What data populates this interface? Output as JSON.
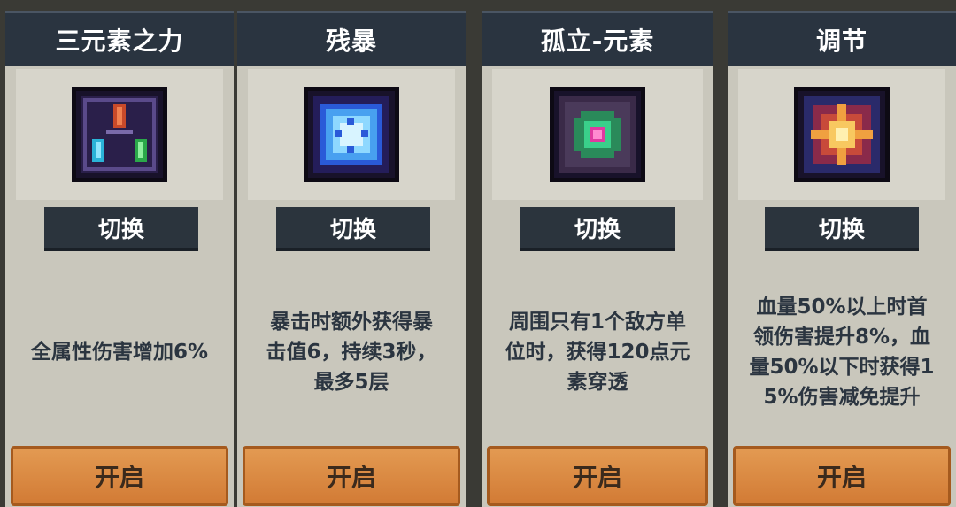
{
  "cards": [
    {
      "title": "三元素之力",
      "icon": "tri-element-crystals-icon",
      "switch_label": "切换",
      "description": "全属性伤害增加6%",
      "open_label": "开启"
    },
    {
      "title": "残暴",
      "icon": "brutal-blue-crystal-icon",
      "switch_label": "切换",
      "description": "暴击时额外获得暴\n击值6，持续3秒，\n最多5层",
      "open_label": "开启"
    },
    {
      "title": "孤立-元素",
      "icon": "isolated-element-orb-icon",
      "switch_label": "切换",
      "description": "周围只有1个敌方单\n位时，获得120点元\n素穿透",
      "open_label": "开启"
    },
    {
      "title": "调节",
      "icon": "adjust-burst-icon",
      "switch_label": "切换",
      "description": "血量50%以上时首\n领伤害提升8%，血\n量50%以下时获得1\n5%伤害减免提升",
      "open_label": "开启"
    }
  ],
  "colors": {
    "card_bg": "#c9c7bc",
    "title_bar": "#2a3440",
    "switch_button": "#2b343d",
    "open_button": "#d88a42",
    "description_text": "#2b3540"
  }
}
